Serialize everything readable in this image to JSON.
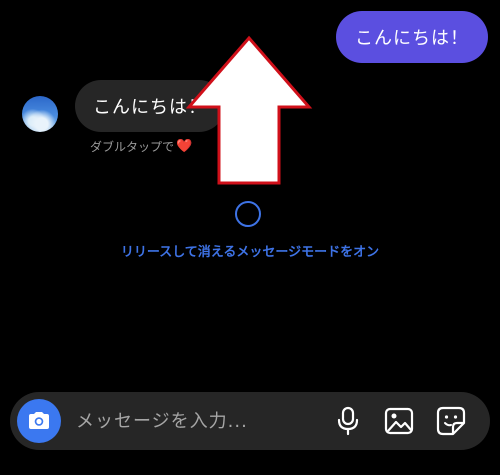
{
  "conversation": {
    "sent_message": "こんにちは！",
    "received_message": "こんにちは！",
    "double_tap_hint": "ダブルタップで",
    "double_tap_heart": "❤️"
  },
  "vanish_mode": {
    "label": "リリースして消えるメッセージモードをオン",
    "accent_color": "#3e73e6"
  },
  "composer": {
    "placeholder": "メッセージを入力...",
    "value": "",
    "camera_icon": "camera-icon",
    "mic_icon": "microphone-icon",
    "gallery_icon": "gallery-icon",
    "sticker_icon": "sticker-icon"
  },
  "colors": {
    "background": "#000000",
    "sent_bubble": "#5b4fe0",
    "received_bubble": "#262626",
    "camera_button": "#3b78f0",
    "annotation_arrow_border": "#d0101a"
  }
}
